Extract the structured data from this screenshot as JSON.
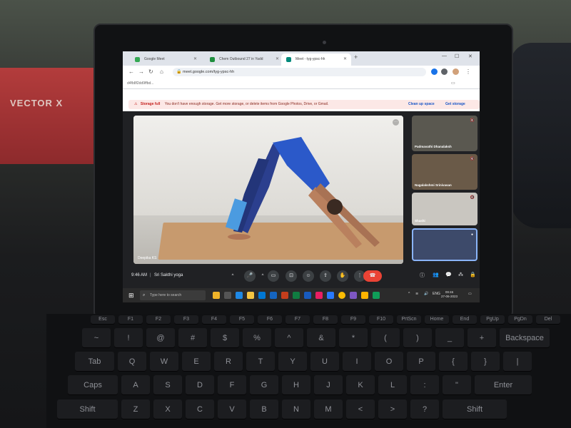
{
  "browser": {
    "tabs": [
      {
        "label": "Google Meet",
        "fav_color": "#34a853"
      },
      {
        "label": "Chem Outbound 27 in Yadd",
        "fav_color": "#1e8e3e"
      },
      {
        "label": "Meet - tyg-ypsc-hh",
        "fav_color": "#00897b"
      }
    ],
    "new_tab": "+",
    "url": "meet.google.com/tyg-ypsc-hh",
    "bookmark": "d4fb8f2dd9ffbd..."
  },
  "storage_banner": {
    "title": "Storage full",
    "message": "You don't have enough storage. Get more storage, or delete items from Google Photos, Drive, or Gmail.",
    "button_clean": "Clean up space",
    "button_get": "Get storage"
  },
  "meet": {
    "main_speaker": "Deepika KS",
    "participants": [
      {
        "name": "Padmavathi Dhanalaksh",
        "bg": "#5a5850"
      },
      {
        "name": "Nagalakshmi Srinivasan",
        "bg": "#6a5a48"
      },
      {
        "name": "Shashi",
        "bg": "#c9c6c0"
      },
      {
        "name": "",
        "bg": "#3d4a6a"
      }
    ],
    "time": "9:46 AM",
    "meeting_title": "Sri Sakthi yoga"
  },
  "taskbar": {
    "search_placeholder": "Type here to search",
    "clock_time": "09:46",
    "clock_date": "27-06-2023",
    "lang": "ENG"
  },
  "keyboard": {
    "fn_labels": [
      "Esc",
      "F1",
      "F2",
      "F3",
      "F4",
      "F5",
      "F6",
      "F7",
      "F8",
      "F9",
      "F10",
      "PrtScn",
      "Home",
      "End",
      "PgUp",
      "PgDn",
      "Del"
    ],
    "number_row": [
      "~",
      "!",
      "@",
      "#",
      "$",
      "%",
      "^",
      "&",
      "*",
      "(",
      ")",
      "_",
      "+",
      "Backspace"
    ],
    "qwerty_row": [
      "Tab",
      "Q",
      "W",
      "E",
      "R",
      "T",
      "Y",
      "U",
      "I",
      "O",
      "P",
      "{",
      "}",
      "|"
    ],
    "asdf_row": [
      "Caps",
      "A",
      "S",
      "D",
      "F",
      "G",
      "H",
      "J",
      "K",
      "L",
      ":",
      "\"",
      "Enter"
    ],
    "zxcv_row": [
      "Shift",
      "Z",
      "X",
      "C",
      "V",
      "B",
      "N",
      "M",
      "<",
      ">",
      "?",
      "Shift"
    ]
  },
  "background": {
    "brand": "VECTOR X"
  }
}
